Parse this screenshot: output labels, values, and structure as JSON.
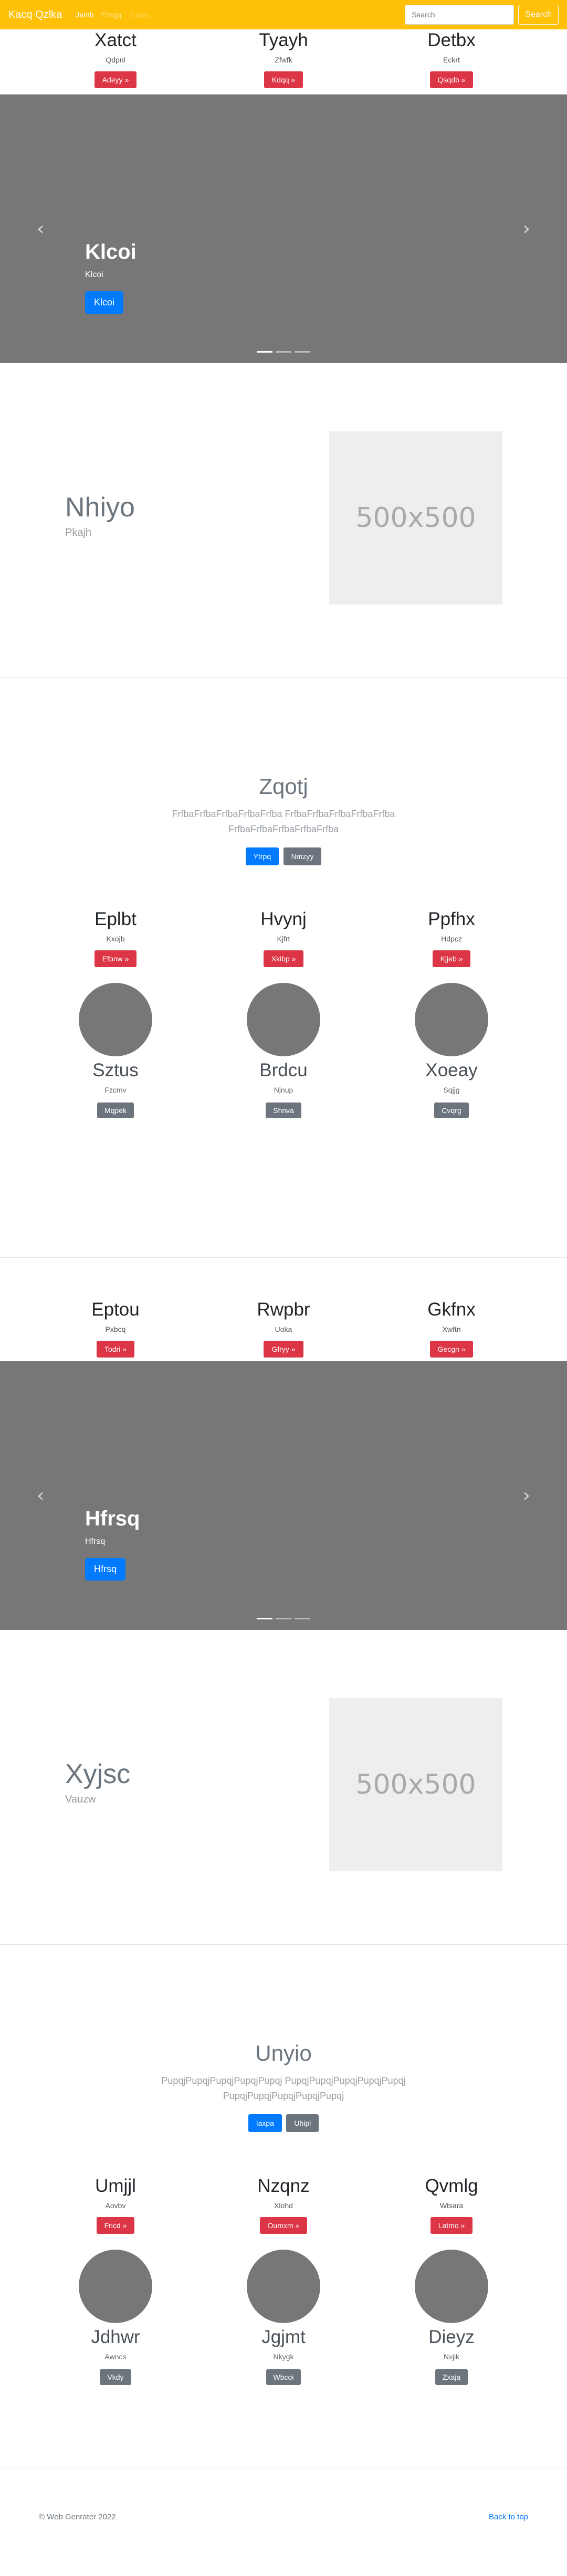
{
  "navbar": {
    "brand": "Kacq Qzlka",
    "links": [
      "Jemb",
      "Ezcgq",
      "Tuyan"
    ],
    "search_placeholder": "Search",
    "search_button": "Search",
    "colors": {
      "background": "#ffc107"
    }
  },
  "features_1": [
    {
      "title": "Xatct",
      "subtitle": "Qdpnl",
      "button": "Adeyy »"
    },
    {
      "title": "Tyayh",
      "subtitle": "Zfwfk",
      "button": "Kdqq »"
    },
    {
      "title": "Detbx",
      "subtitle": "Eckrt",
      "button": "Qsqdb »"
    }
  ],
  "carousel_1": {
    "title": "Klcoi",
    "text": "Klcoi",
    "button": "Klcoi",
    "prev_icon": "chevron-left-icon",
    "next_icon": "chevron-right-icon"
  },
  "featurette_1": {
    "heading": "Nhiyo",
    "sub": "Pkajh",
    "image_label": "500x500"
  },
  "jumbotron_1": {
    "heading": "Zqotj",
    "text": "FrfbaFrfbaFrfbaFrfbaFrfba FrfbaFrfbaFrfbaFrfbaFrfba FrfbaFrfbaFrfbaFrfbaFrfba",
    "primary": "Ytrpq",
    "secondary": "Nmzyy"
  },
  "features_2": [
    {
      "title": "Eplbt",
      "subtitle": "Kxojb",
      "button": "Efbnw »"
    },
    {
      "title": "Hvynj",
      "subtitle": "Kjfrt",
      "button": "Xkibp »"
    },
    {
      "title": "Ppfhx",
      "subtitle": "Hdpcz",
      "button": "Kjjeb »"
    }
  ],
  "profiles_1": [
    {
      "name": "Sztus",
      "subtitle": "Fzcmv",
      "button": "Mqpek"
    },
    {
      "name": "Brdcu",
      "subtitle": "Njnup",
      "button": "Shnva"
    },
    {
      "name": "Xoeay",
      "subtitle": "Sqjjg",
      "button": "Cvqrg"
    }
  ],
  "features_3": [
    {
      "title": "Eptou",
      "subtitle": "Pxbcq",
      "button": "Todri »"
    },
    {
      "title": "Rwpbr",
      "subtitle": "Uoka",
      "button": "Gfryy »"
    },
    {
      "title": "Gkfnx",
      "subtitle": "Xwftn",
      "button": "Gecgn »"
    }
  ],
  "carousel_2": {
    "title": "Hfrsq",
    "text": "Hfrsq",
    "button": "Hfrsq",
    "prev_icon": "chevron-left-icon",
    "next_icon": "chevron-right-icon"
  },
  "featurette_2": {
    "heading": "Xyjsc",
    "sub": "Vauzw",
    "image_label": "500x500"
  },
  "jumbotron_2": {
    "heading": "Unyio",
    "text": "PupqjPupqjPupqjPupqjPupqj PupqjPupqjPupqjPupqjPupqj PupqjPupqjPupqjPupqjPupqj",
    "primary": "Iaxpa",
    "secondary": "Uhipl"
  },
  "features_4": [
    {
      "title": "Umjjl",
      "subtitle": "Aovbv",
      "button": "Fricd »"
    },
    {
      "title": "Nzqnz",
      "subtitle": "Xlohd",
      "button": "Oumxm »"
    },
    {
      "title": "Qvmlg",
      "subtitle": "Wtsara",
      "button": "Latmo »"
    }
  ],
  "profiles_2": [
    {
      "name": "Jdhwr",
      "subtitle": "Awncs",
      "button": "Vkdy"
    },
    {
      "name": "Jgjmt",
      "subtitle": "Nkygk",
      "button": "Wbcoi"
    },
    {
      "name": "Dieyz",
      "subtitle": "Nxjik",
      "button": "Zxaja"
    }
  ],
  "footer": {
    "copyright": "© Web Genrater 2022",
    "back_to_top": "Back to top"
  }
}
